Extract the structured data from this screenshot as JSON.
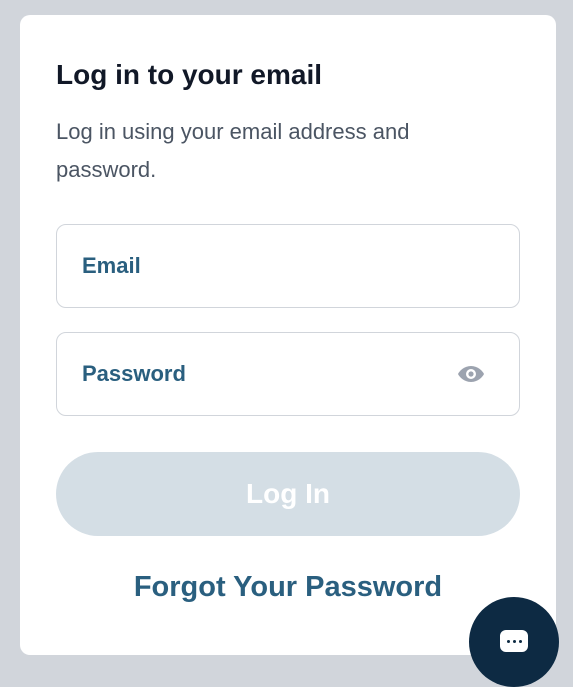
{
  "login": {
    "title": "Log in to your email",
    "subtitle": "Log in using your email address and password.",
    "email_label": "Email",
    "password_label": "Password",
    "login_button": "Log In",
    "forgot_link": "Forgot Your Password"
  },
  "icons": {
    "password_toggle": "eye-icon",
    "chat": "chat-icon"
  },
  "colors": {
    "page_bg": "#d1d5db",
    "card_bg": "#ffffff",
    "title": "#111827",
    "subtitle": "#4b5563",
    "accent": "#2a5f7f",
    "button_disabled_bg": "#d4dee5",
    "chat_bubble": "#0d2a43"
  }
}
